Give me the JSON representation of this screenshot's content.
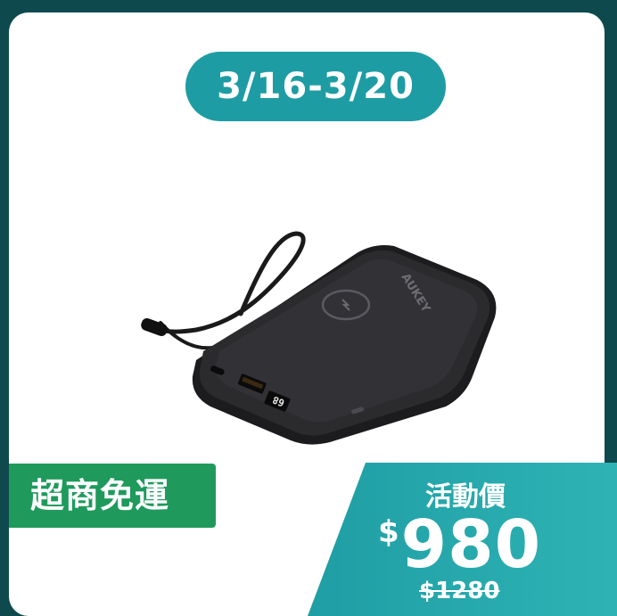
{
  "promo": {
    "date_range": "3/16-3/20",
    "shipping_badge": "超商免運",
    "price_label": "活動價",
    "currency": "$",
    "sale_price": "980",
    "original_price": "$1280"
  },
  "product": {
    "brand_mark": "AUKEY",
    "display_digits": "68"
  },
  "colors": {
    "background": "#0e4a4d",
    "teal_pill": "#1e9ca3",
    "green_badge": "#1f9a5c",
    "price_panel": "#26a9ad"
  }
}
